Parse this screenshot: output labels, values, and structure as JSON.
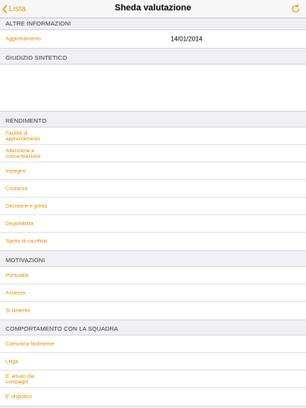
{
  "nav": {
    "back_label": "Lista",
    "title": "Sheda valutazione"
  },
  "altre_informazioni": {
    "header": "ALTRE INFORMAZIONI",
    "rows": [
      {
        "label": "Aggiornamento",
        "value": "14/01/2014"
      }
    ]
  },
  "giudizio": {
    "header": "GIUDIZIO SINTETICO",
    "text": ""
  },
  "rendimento": {
    "header": "RENDIMENTO",
    "rows": [
      {
        "label": "Facilità di apprendimento"
      },
      {
        "label": "Attenzione e concentrazione"
      },
      {
        "label": "Impegno"
      },
      {
        "label": "Costanza"
      },
      {
        "label": "Decisione e grinta"
      },
      {
        "label": "Disponibilità"
      },
      {
        "label": "Spirito di sacrificio"
      }
    ]
  },
  "motivazioni": {
    "header": "MOTIVAZIONI",
    "rows": [
      {
        "label": "Puntualità"
      },
      {
        "label": "Assenze"
      },
      {
        "label": "Si lamenta"
      }
    ]
  },
  "comportamento": {
    "header": "COMPORTAMENTO CON LA SQUADRA",
    "rows": [
      {
        "label": "Comunica facilmente"
      },
      {
        "label": "Litiga"
      },
      {
        "label": "E' amato dai compagni"
      },
      {
        "label": "E' dispotico"
      }
    ]
  },
  "colors": {
    "accent": "#f29400",
    "background": "#efeff4",
    "cell": "#ffffff"
  }
}
